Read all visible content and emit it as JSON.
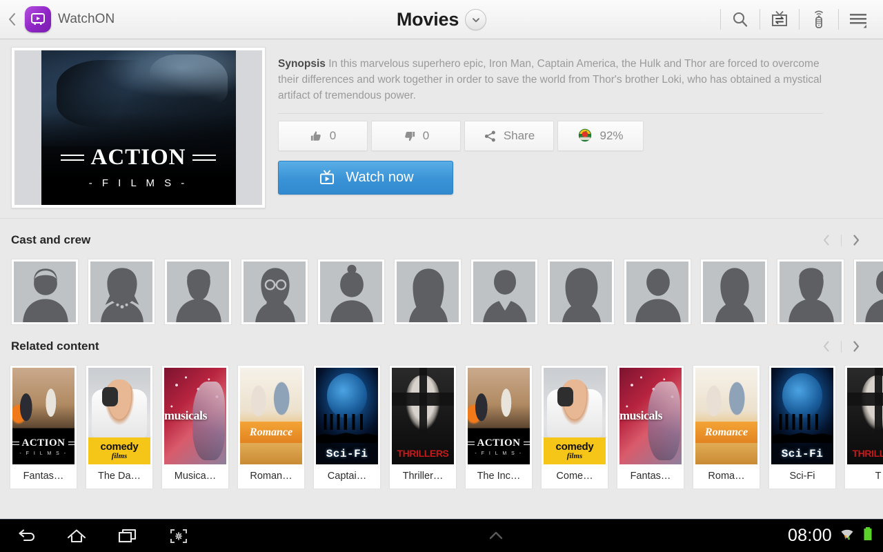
{
  "header": {
    "back_icon": "back-chevron-icon",
    "app_icon": "watchon-app-icon",
    "app_name": "WatchON",
    "title": "Movies",
    "dropdown_icon": "chevron-down-icon",
    "actions": [
      {
        "name": "search-icon",
        "label": "Search"
      },
      {
        "name": "tv-switch-icon",
        "label": "Change TV"
      },
      {
        "name": "remote-control-icon",
        "label": "Remote"
      },
      {
        "name": "menu-icon",
        "label": "Menu"
      }
    ]
  },
  "detail": {
    "poster": {
      "title": "ACTION",
      "subtitle": "- F I L M S -"
    },
    "synopsis_label": "Synopsis",
    "synopsis_text": " In this marvelous superhero epic, Iron Man, Captain America, the Hulk and Thor are forced to overcome their differences and work together in order to save the world from Thor's brother Loki, who has obtained a mystical artifact of tremendous power.",
    "buttons": {
      "like_count": "0",
      "dislike_count": "0",
      "share_label": "Share",
      "score_value": "92%"
    },
    "watch_label": "Watch now"
  },
  "cast_section": {
    "title": "Cast and crew",
    "prev_icon": "chevron-left-icon",
    "next_icon": "chevron-right-icon",
    "items": [
      {
        "avatar": "male-short-hair"
      },
      {
        "avatar": "female-bob-necklace"
      },
      {
        "avatar": "male-beard"
      },
      {
        "avatar": "female-glasses"
      },
      {
        "avatar": "male-bun"
      },
      {
        "avatar": "female-long-hair"
      },
      {
        "avatar": "male-suit"
      },
      {
        "avatar": "female-wavy"
      },
      {
        "avatar": "male-plain"
      },
      {
        "avatar": "female-straight"
      },
      {
        "avatar": "male-beard-two"
      },
      {
        "avatar": "partial-edge"
      }
    ]
  },
  "related_section": {
    "title": "Related content",
    "prev_icon": "chevron-left-icon",
    "next_icon": "chevron-right-icon",
    "items": [
      {
        "label": "Fantas…",
        "art": "action",
        "art_title": "ACTION",
        "art_sub": "- F I L M S -"
      },
      {
        "label": "The Da…",
        "art": "comedy",
        "art_title": "comedy",
        "art_sub": "films"
      },
      {
        "label": "Musica…",
        "art": "musicals",
        "art_title": "musicals",
        "art_sub": ""
      },
      {
        "label": "Roman…",
        "art": "romance",
        "art_title": "Romance",
        "art_sub": ""
      },
      {
        "label": "Captai…",
        "art": "scifi",
        "art_title": "Sci-Fi",
        "art_sub": ""
      },
      {
        "label": "Thriller…",
        "art": "thriller",
        "art_title": "THRILLERS",
        "art_sub": ""
      },
      {
        "label": "The Inc…",
        "art": "action",
        "art_title": "ACTION",
        "art_sub": "- F I L M S -"
      },
      {
        "label": "Come…",
        "art": "comedy",
        "art_title": "comedy",
        "art_sub": "films"
      },
      {
        "label": "Fantas…",
        "art": "musicals",
        "art_title": "musicals",
        "art_sub": ""
      },
      {
        "label": "Roma…",
        "art": "romance",
        "art_title": "Romance",
        "art_sub": ""
      },
      {
        "label": "Sci-Fi",
        "art": "scifi",
        "art_title": "Sci-Fi",
        "art_sub": ""
      },
      {
        "label": "T",
        "art": "thriller",
        "art_title": "THRILLERS",
        "art_sub": ""
      }
    ]
  },
  "navbar": {
    "back_icon": "back-arrow-icon",
    "home_icon": "home-icon",
    "recents_icon": "recent-apps-icon",
    "screenshot_icon": "screen-capture-icon",
    "expand_icon": "chevron-up-icon",
    "clock": "08:00",
    "wifi_icon": "wifi-icon",
    "battery_icon": "battery-icon"
  },
  "colors": {
    "accent_blue": "#3a93d6",
    "app_purple": "#8e24c4",
    "battery_green": "#5bd22a",
    "page_bg": "#e9e9e9"
  }
}
